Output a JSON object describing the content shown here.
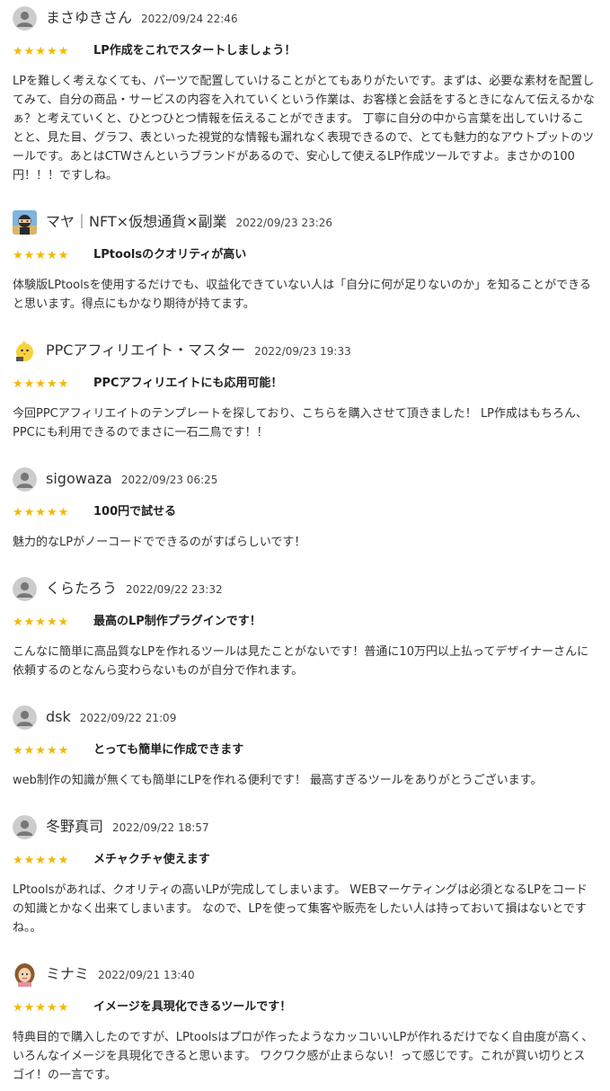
{
  "reviews": [
    {
      "name": "まさゆきさん",
      "date": "2022/09/24 22:46",
      "avatar": "default-user-icon",
      "stars": "★★★★★",
      "rating": 5,
      "title": "LP作成をこれでスタートしましょう！",
      "body": "LPを難しく考えなくても、パーツで配置していけることがとてもありがたいです。まずは、必要な素材を配置してみて、自分の商品・サービスの内容を入れていくという作業は、お客様と会話をするときになんて伝えるかなぁ？と考えていくと、ひとつひとつ情報を伝えることができます。 丁寧に自分の中から言葉を出していけることと、見た目、グラフ、表といった視覚的な情報も漏れなく表現できるので、とても魅力的なアウトプットのツールです。あとはCTWさんというブランドがあるので、安心して使えるLP作成ツールですよ。まさかの100円！！！ですしね。"
    },
    {
      "name": "マヤ｜NFT×仮想通貨×副業",
      "date": "2022/09/23 23:26",
      "avatar": "ninja-avatar-icon",
      "stars": "★★★★★",
      "rating": 5,
      "title": "LPtoolsのクオリティが高い",
      "body": "体験版LPtoolsを使用するだけでも、収益化できていない人は「自分に何が足りないのか」を知ることができると思います。得点にもかなり期待が持てます。"
    },
    {
      "name": "PPCアフィリエイト・マスター",
      "date": "2022/09/23 19:33",
      "avatar": "chick-avatar-icon",
      "stars": "★★★★★",
      "rating": 5,
      "title": "PPCアフィリエイトにも応用可能！",
      "body": "今回PPCアフィリエイトのテンプレートを探しており、こちらを購入させて頂きました！ LP作成はもちろん、PPCにも利用できるのでまさに一石二鳥です！！"
    },
    {
      "name": "sigowaza",
      "date": "2022/09/23 06:25",
      "avatar": "default-user-icon",
      "stars": "★★★★★",
      "rating": 5,
      "title": "100円で試せる",
      "body": "魅力的なLPがノーコードでできるのがすばらしいです！"
    },
    {
      "name": "くらたろう",
      "date": "2022/09/22 23:32",
      "avatar": "default-user-icon",
      "stars": "★★★★★",
      "rating": 5,
      "title": "最高のLP制作プラグインです！",
      "body": "こんなに簡単に高品質なLPを作れるツールは見たことがないです！普通に10万円以上払ってデザイナーさんに依頼するのとなんら変わらないものが自分で作れます。"
    },
    {
      "name": "dsk",
      "date": "2022/09/22 21:09",
      "avatar": "default-user-icon",
      "stars": "★★★★★",
      "rating": 5,
      "title": "とっても簡単に作成できます",
      "body": "web制作の知識が無くても簡単にLPを作れる便利です！ 最高すぎるツールをありがとうございます。"
    },
    {
      "name": "冬野真司",
      "date": "2022/09/22 18:57",
      "avatar": "default-user-icon",
      "stars": "★★★★★",
      "rating": 5,
      "title": "メチャクチャ使えます",
      "body": "LPtoolsがあれば、クオリティの高いLPが完成してしまいます。 WEBマーケティングは必須となるLPをコードの知識とかなく出来てしまいます。 なので、LPを使って集客や販売をしたい人は持っておいて損はないとですね。。"
    },
    {
      "name": "ミナミ",
      "date": "2022/09/21 13:40",
      "avatar": "girl-avatar-icon",
      "stars": "★★★★★",
      "rating": 5,
      "title": "イメージを具現化できるツールです！",
      "body": "特典目的で購入したのですが、LPtoolsはプロが作ったようなカッコいいLPが作れるだけでなく自由度が高く、いろんなイメージを具現化できると思います。 ワクワク感が止まらない！って感じです。これが買い切りとスゴイ！の一言です。"
    }
  ],
  "colors": {
    "star": "#f5b800",
    "avatar_bg": "#cccccc",
    "text": "#333333"
  }
}
